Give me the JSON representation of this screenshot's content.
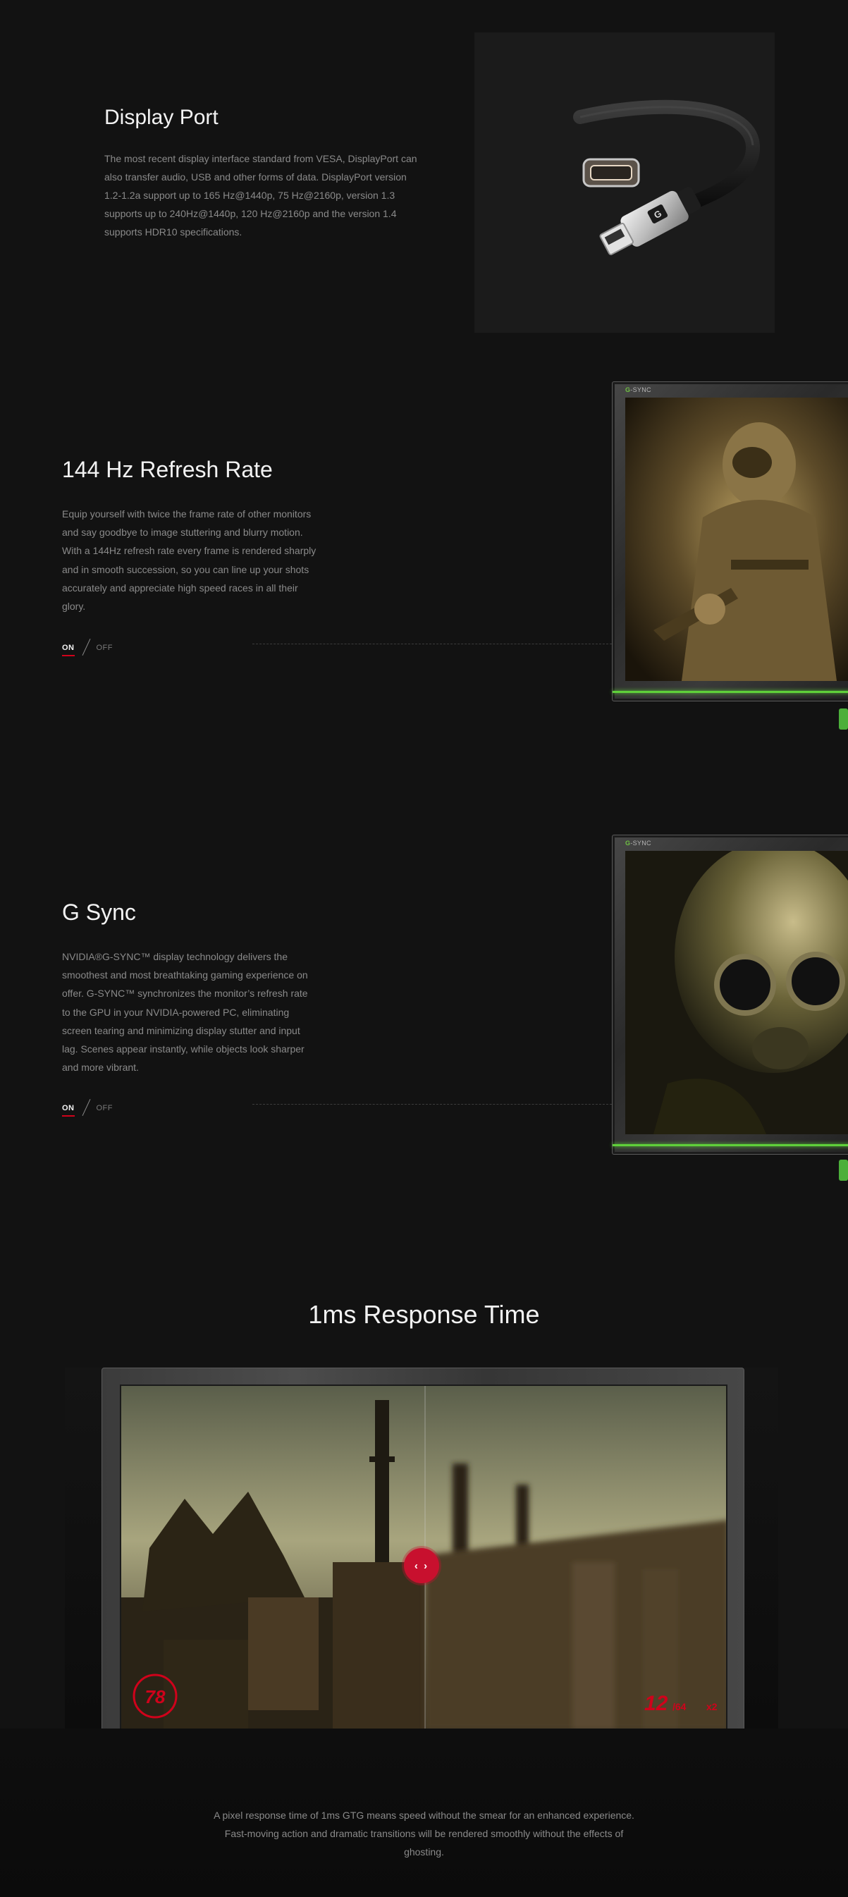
{
  "display_port": {
    "title": "Display Port",
    "body": "The most recent display interface standard from VESA, DisplayPort can also transfer audio, USB and other forms of data. DisplayPort version 1.2-1.2a support up to 165 Hz@1440p, 75 Hz@2160p, version 1.3 supports up to 240Hz@1440p, 120 Hz@2160p and the version 1.4 supports HDR10 specifications."
  },
  "refresh_rate": {
    "title": "144 Hz Refresh Rate",
    "body": "Equip yourself with twice the frame rate of other monitors and say goodbye to image stuttering and blurry motion. With a 144Hz refresh rate every frame is rendered sharply and in smooth succession, so you can line up your shots accurately and appreciate high speed races in all their glory.",
    "toggle_on": "ON",
    "toggle_off": "OFF",
    "monitor_badge_prefix": "G",
    "monitor_badge_rest": "-SYNC"
  },
  "g_sync": {
    "title": "G Sync",
    "body": "NVIDIA®G-SYNC™ display technology delivers the smoothest and most breathtaking gaming experience on offer. G-SYNC™ synchronizes the monitor’s refresh rate to the GPU in your NVIDIA-powered PC, eliminating screen tearing and minimizing display stutter and input lag. Scenes appear instantly, while objects look sharper and more vibrant.",
    "toggle_on": "ON",
    "toggle_off": "OFF",
    "monitor_badge_prefix": "G",
    "monitor_badge_rest": "-SYNC"
  },
  "response_time": {
    "title": "1ms Response Time",
    "slider_label": "‹ ›",
    "hud_speed": "78",
    "hud_ammo": "12",
    "hud_ammo_max": "/64",
    "hud_grenades": "x2",
    "body": "A pixel response time of 1ms GTG means speed without the smear for an enhanced experience. Fast-moving action and dramatic transitions will be rendered smoothly without the effects of ghosting."
  },
  "colors": {
    "background": "#121212",
    "accent_red": "#c8102e",
    "gsync_green": "#5fd03a",
    "body_text": "#8a8a8a"
  }
}
